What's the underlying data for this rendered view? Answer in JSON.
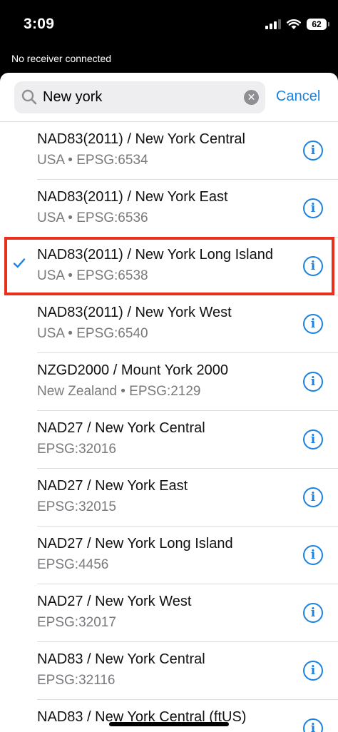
{
  "status_bar": {
    "time": "3:09",
    "battery": "62"
  },
  "receiver_status": "No receiver connected",
  "search": {
    "value": "New york",
    "cancel_label": "Cancel"
  },
  "results": [
    {
      "title": "NAD83(2011) / New York Central",
      "subtitle": "USA • EPSG:6534",
      "selected": false
    },
    {
      "title": "NAD83(2011) / New York East",
      "subtitle": "USA • EPSG:6536",
      "selected": false
    },
    {
      "title": "NAD83(2011) / New York Long Island",
      "subtitle": "USA • EPSG:6538",
      "selected": true
    },
    {
      "title": "NAD83(2011) / New York West",
      "subtitle": "USA • EPSG:6540",
      "selected": false
    },
    {
      "title": "NZGD2000 / Mount York 2000",
      "subtitle": "New Zealand • EPSG:2129",
      "selected": false
    },
    {
      "title": "NAD27 / New York Central",
      "subtitle": "EPSG:32016",
      "selected": false
    },
    {
      "title": "NAD27 / New York East",
      "subtitle": "EPSG:32015",
      "selected": false
    },
    {
      "title": "NAD27 / New York Long Island",
      "subtitle": "EPSG:4456",
      "selected": false
    },
    {
      "title": "NAD27 / New York West",
      "subtitle": "EPSG:32017",
      "selected": false
    },
    {
      "title": "NAD83 / New York Central",
      "subtitle": "EPSG:32116",
      "selected": false
    },
    {
      "title": "NAD83 / New York Central (ftUS)",
      "subtitle": "",
      "selected": false
    }
  ],
  "colors": {
    "accent": "#1a82e2",
    "highlight": "#e8301f"
  }
}
